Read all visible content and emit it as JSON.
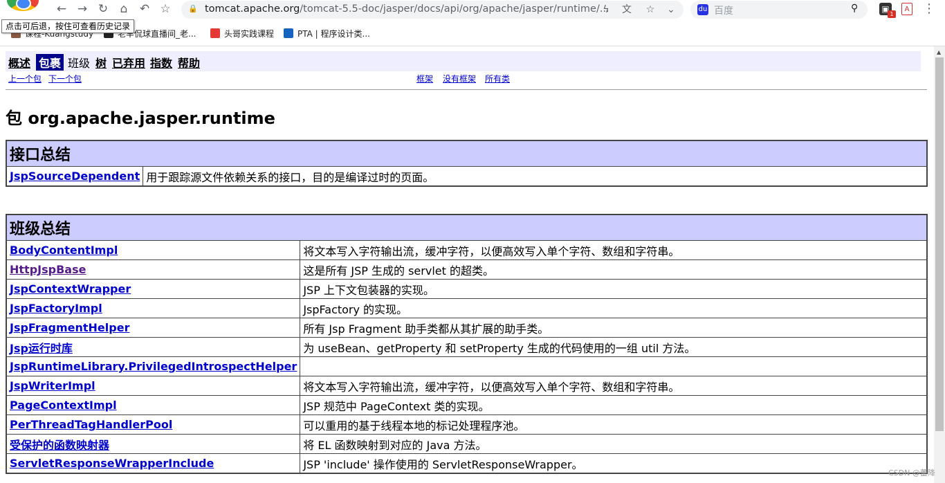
{
  "browser": {
    "url_host": "tomcat.apache.org",
    "url_path": "/tomcat-5.5-doc/jasper/docs/api/org/apache/jasper/runtime/...",
    "search_placeholder": "百度",
    "ext_badge": "1",
    "tooltip": "点击可后退，按住可查看历史记录",
    "bookmarks": [
      {
        "label": "课程-Kuangstudy",
        "color": "#8a5a44"
      },
      {
        "label": "老罕侃球直播间_老...",
        "color": "#222222"
      },
      {
        "label": "头哥实践课程",
        "color": "#e53935"
      },
      {
        "label": "PTA | 程序设计类...",
        "color": "#1565c0"
      }
    ],
    "watermark": "CSDN @蕾降"
  },
  "navbar": {
    "overview": "概述",
    "package": "包裹",
    "class": "班级",
    "tree": "树",
    "deprecated": "已弃用",
    "index": "指数",
    "help": "帮助"
  },
  "subnav": {
    "prev_package": "上一个包",
    "next_package": "下一个包",
    "frames": "框架",
    "no_frames": "没有框架",
    "all_classes": "所有类"
  },
  "package_title": "包 org.apache.jasper.runtime",
  "interfaces": {
    "header": "接口总结",
    "rows": [
      {
        "name": "JspSourceDependent",
        "desc": "用于跟踪源文件依赖关系的接口，目的是编译过时的页面。"
      }
    ]
  },
  "classes": {
    "header": "班级总结",
    "rows": [
      {
        "name": "BodyContentImpl",
        "desc": "将文本写入字符输出流，缓冲字符，以便高效写入单个字符、数组和字符串。"
      },
      {
        "name": "HttpJspBase",
        "desc": "这是所有 JSP 生成的 servlet 的超类。"
      },
      {
        "name": "JspContextWrapper",
        "desc": "JSP 上下文包装器的实现。"
      },
      {
        "name": "JspFactoryImpl",
        "desc": "JspFactory 的实现。"
      },
      {
        "name": "JspFragmentHelper",
        "desc": "所有 Jsp Fragment 助手类都从其扩展的助手类。"
      },
      {
        "name": "Jsp运行时库",
        "desc": "为 useBean、getProperty 和 setProperty 生成的代码使用的一组 util 方法。"
      },
      {
        "name": "JspRuntimeLibrary.PrivilegedIntrospectHelper",
        "desc": ""
      },
      {
        "name": "JspWriterImpl",
        "desc": "将文本写入字符输出流，缓冲字符，以便高效写入单个字符、数组和字符串。"
      },
      {
        "name": "PageContextImpl",
        "desc": "JSP 规范中 PageContext 类的实现。"
      },
      {
        "name": "PerThreadTagHandlerPool",
        "desc": "可以重用的基于线程本地的标记处理程序池。"
      },
      {
        "name": "受保护的函数映射器",
        "desc": "将 EL 函数映射到对应的 Java 方法。"
      },
      {
        "name": "ServletResponseWrapperInclude",
        "desc": "JSP 'include' 操作使用的 ServletResponseWrapper。"
      }
    ]
  }
}
